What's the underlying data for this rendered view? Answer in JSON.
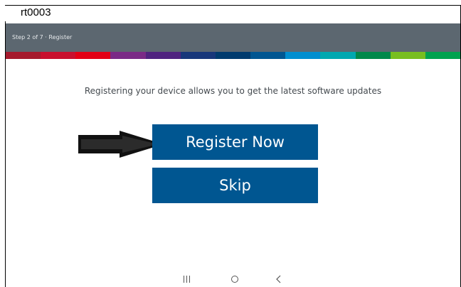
{
  "document": {
    "ref_code": "rt0003"
  },
  "header": {
    "step_text": "Step 2 of 7 · Register"
  },
  "brand_strip_colors": [
    "#a51a2d",
    "#c8102e",
    "#e20015",
    "#7a2a86",
    "#50237f",
    "#18377a",
    "#003b6e",
    "#005691",
    "#008ecf",
    "#00a8b0",
    "#00884a",
    "#78be20",
    "#00a24f"
  ],
  "main": {
    "instruction": "Registering your device allows you to get the latest software updates",
    "register_label": "Register Now",
    "skip_label": "Skip"
  },
  "colors": {
    "header_bg": "#5c6770",
    "button_bg": "#005691",
    "button_text": "#ffffff"
  },
  "icons": {
    "pointer": "arrow-right-icon",
    "recents": "recents-icon",
    "home": "home-icon",
    "back": "back-icon"
  }
}
